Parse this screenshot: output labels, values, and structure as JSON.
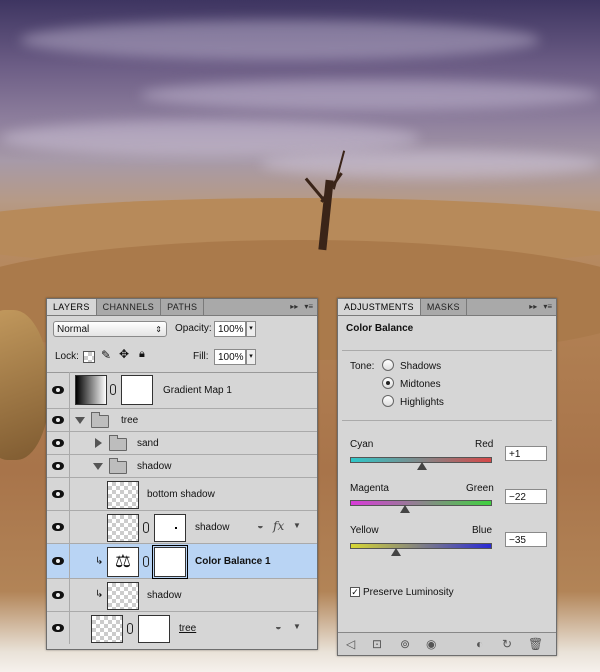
{
  "layers_panel": {
    "tabs": [
      {
        "label": "LAYERS",
        "active": true
      },
      {
        "label": "CHANNELS",
        "active": false
      },
      {
        "label": "PATHS",
        "active": false
      }
    ],
    "blend_mode": "Normal",
    "opacity_label": "Opacity:",
    "opacity_value": "100%",
    "lock_label": "Lock:",
    "fill_label": "Fill:",
    "fill_value": "100%",
    "layers": [
      {
        "name": "Gradient Map 1",
        "type": "adjustment",
        "visible": true
      },
      {
        "name": "tree",
        "type": "group",
        "expanded": true,
        "visible": true
      },
      {
        "name": "sand",
        "type": "group",
        "expanded": false,
        "visible": true
      },
      {
        "name": "shadow",
        "type": "group",
        "expanded": true,
        "visible": true
      },
      {
        "name": "bottom shadow",
        "type": "pixel",
        "visible": true
      },
      {
        "name": "shadow",
        "type": "smart_object_fx",
        "visible": true
      },
      {
        "name": "Color Balance 1",
        "type": "adjustment",
        "selected": true,
        "visible": true
      },
      {
        "name": "shadow",
        "type": "pixel_clipped",
        "visible": true
      },
      {
        "name": "tree",
        "type": "smart_object",
        "visible": true
      }
    ]
  },
  "adjustments_panel": {
    "tabs": [
      {
        "label": "ADJUSTMENTS",
        "active": true
      },
      {
        "label": "MASKS",
        "active": false
      }
    ],
    "title": "Color Balance",
    "tone_label": "Tone:",
    "tones": [
      {
        "label": "Shadows",
        "selected": false
      },
      {
        "label": "Midtones",
        "selected": true
      },
      {
        "label": "Highlights",
        "selected": false
      }
    ],
    "sliders": [
      {
        "left": "Cyan",
        "right": "Red",
        "value": "+1",
        "position": 0.505,
        "gradient": [
          "#2ec7c9",
          "#d64848"
        ]
      },
      {
        "left": "Magenta",
        "right": "Green",
        "value": "−22",
        "position": 0.39,
        "gradient": [
          "#d93ad9",
          "#3fd23f"
        ]
      },
      {
        "left": "Yellow",
        "right": "Blue",
        "value": "−35",
        "position": 0.325,
        "gradient": [
          "#d6d633",
          "#2a2ad6"
        ]
      }
    ],
    "preserve_luminosity_label": "Preserve Luminosity",
    "preserve_luminosity": true
  },
  "icons": {
    "visibility": "eye-icon",
    "menu": "panel-menu-icon",
    "fx": "fx-icon"
  }
}
